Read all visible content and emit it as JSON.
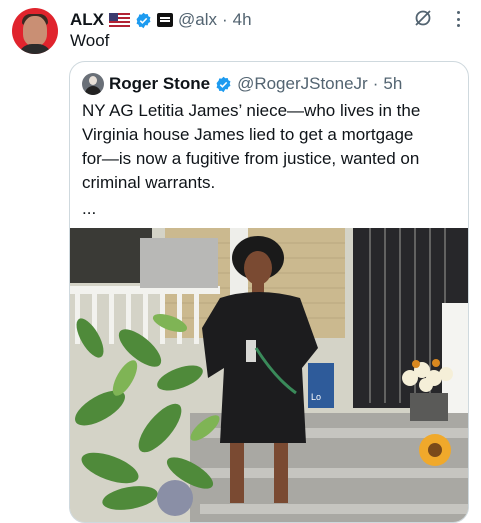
{
  "tweet": {
    "author_name": "ALX",
    "handle": "@alx",
    "separator": "·",
    "time": "4h",
    "text": "Woof"
  },
  "quote": {
    "author_name": "Roger Stone",
    "handle": "@RogerJStoneJr",
    "separator": "·",
    "time": "5h",
    "text_lines": [
      "NY AG Letitia James’ niece—who lives in the",
      "Virginia house James lied to get a mortgage",
      "for—is now a fugitive from justice, wanted on",
      "criminal warrants."
    ],
    "ellipsis": "...",
    "photo_sign": "Lo"
  },
  "colors": {
    "text": "#0f1419",
    "secondary": "#536471",
    "verified": "#1d9bf0",
    "border": "#cfd9de",
    "avatar_bg": "#e0242d"
  },
  "icons": [
    "us-flag-icon",
    "verified-badge-icon",
    "affiliate-badge-icon",
    "grok-icon",
    "more-options-icon"
  ]
}
